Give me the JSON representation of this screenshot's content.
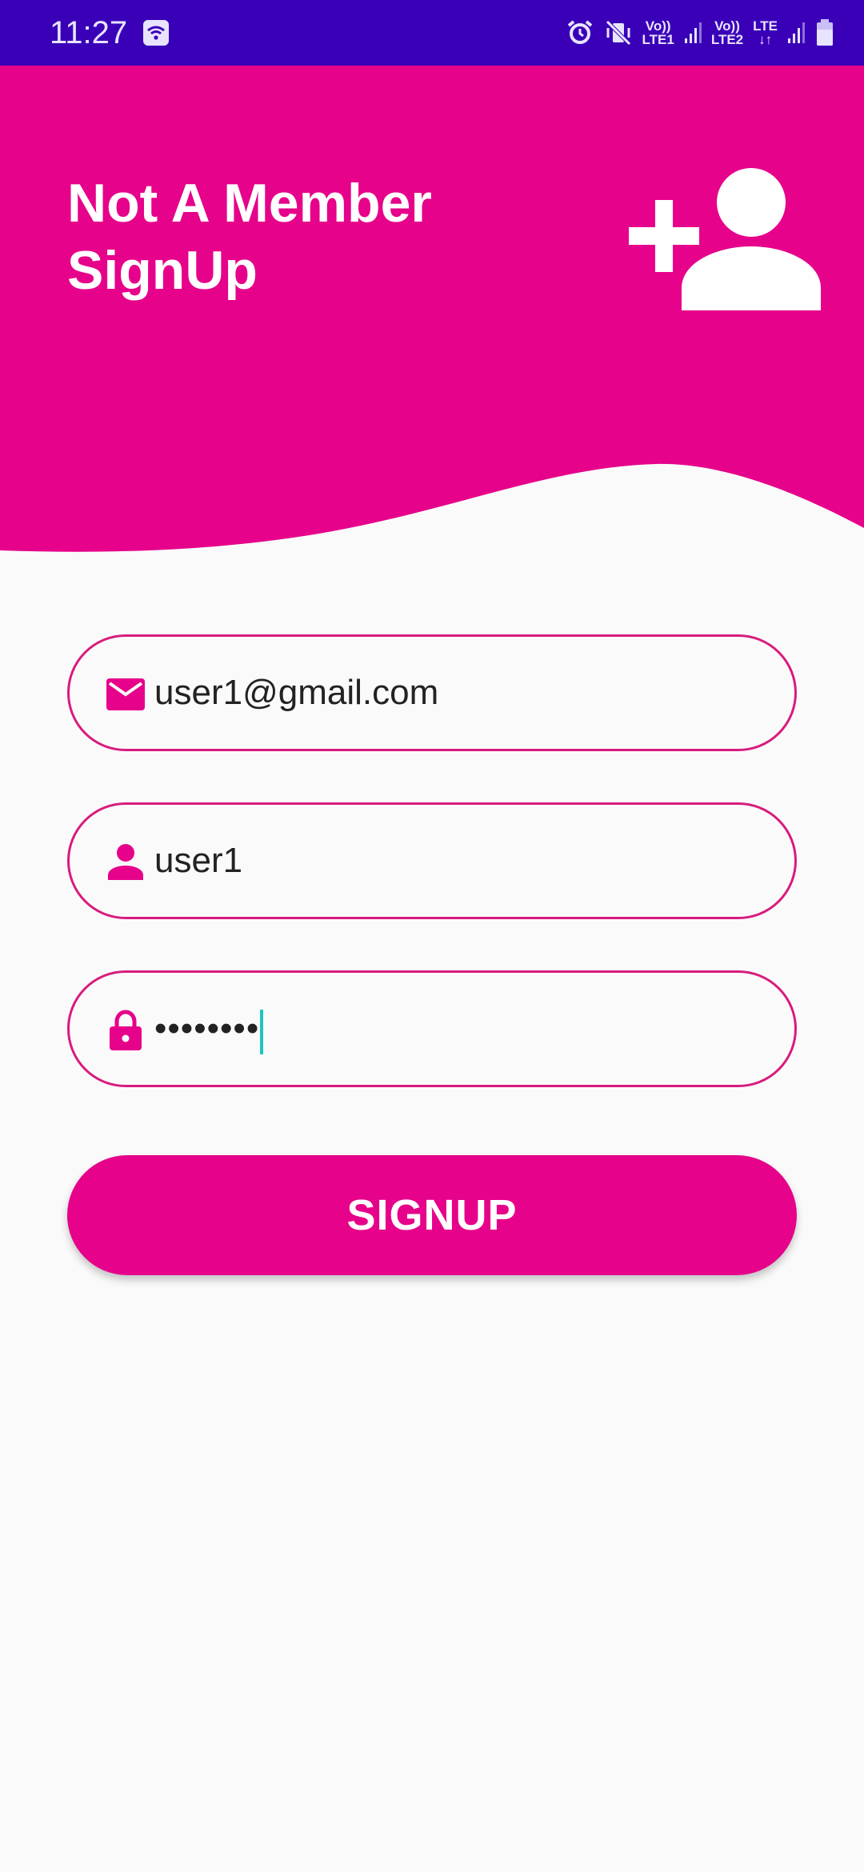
{
  "status_bar": {
    "time": "11:27",
    "sim1_top": "Vo))",
    "sim1_bottom": "LTE1",
    "sim2_top": "Vo))",
    "sim2_bottom": "LTE2",
    "lte_label": "LTE",
    "icons": [
      "wifi-icon",
      "alarm-icon",
      "vibrate-mute-icon",
      "signal-icon",
      "battery-icon"
    ]
  },
  "header": {
    "title_line1": "Not A Member",
    "title_line2": "SignUp",
    "icon": "add-user-icon"
  },
  "form": {
    "email": {
      "value": "user1@gmail.com",
      "icon": "email-icon"
    },
    "username": {
      "value": "user1",
      "icon": "person-icon"
    },
    "password": {
      "value": "••••••••",
      "icon": "lock-icon"
    },
    "signup_label": "SIGNUP"
  },
  "colors": {
    "status_bar": "#3a00b8",
    "accent": "#e6028a",
    "field_border": "#d81b7f",
    "background": "#fafafa",
    "cursor": "#1fc3c3"
  }
}
